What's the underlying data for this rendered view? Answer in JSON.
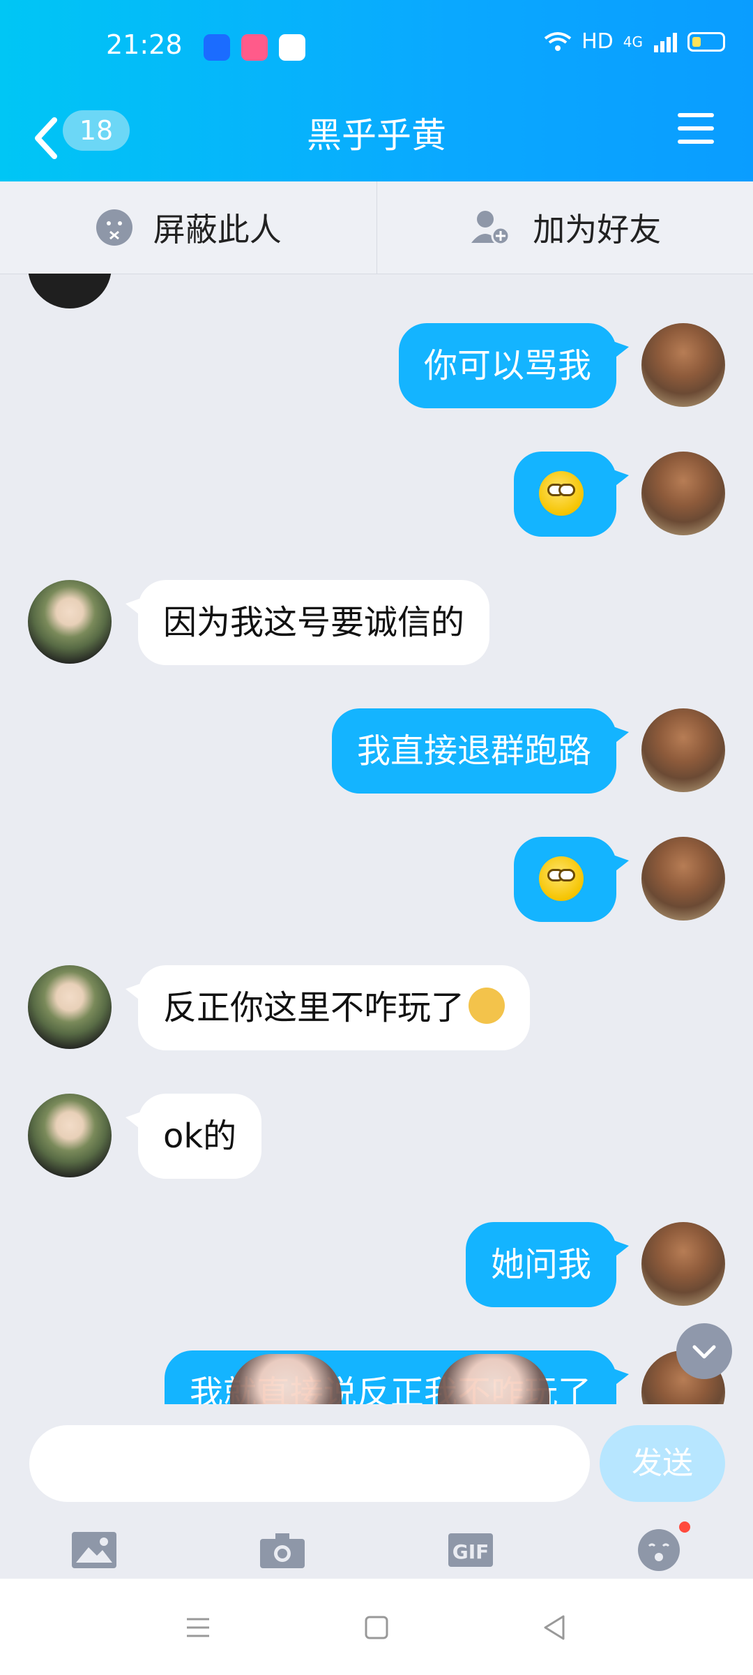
{
  "status_bar": {
    "time": "21:28",
    "network": "HD",
    "signal": "4G"
  },
  "header": {
    "back_count": "18",
    "title": "黑乎乎黄"
  },
  "actions": {
    "block_label": "屏蔽此人",
    "add_friend_label": "加为好友"
  },
  "messages": [
    {
      "side": "out",
      "text": "你可以骂我"
    },
    {
      "side": "out",
      "emoji": "smile-emoji"
    },
    {
      "side": "in",
      "text": "因为我这号要诚信的"
    },
    {
      "side": "out",
      "text": "我直接退群跑路"
    },
    {
      "side": "out",
      "emoji": "smile-emoji"
    },
    {
      "side": "in",
      "text": "反正你这里不咋玩了"
    },
    {
      "side": "in",
      "text": "ok的"
    },
    {
      "side": "out",
      "text": "她问我"
    },
    {
      "side": "out",
      "text": "我就直接说反正我不咋玩了"
    }
  ],
  "input": {
    "placeholder": "",
    "send_label": "发送"
  },
  "toolbar": {
    "items": [
      "image-icon",
      "camera-icon",
      "gif-icon",
      "emoji-icon"
    ]
  },
  "colors": {
    "header_start": "#00c6f5",
    "header_end": "#0a9dff",
    "bubble_out": "#14b4ff",
    "bubble_in": "#ffffff",
    "background": "#eaecf2"
  }
}
